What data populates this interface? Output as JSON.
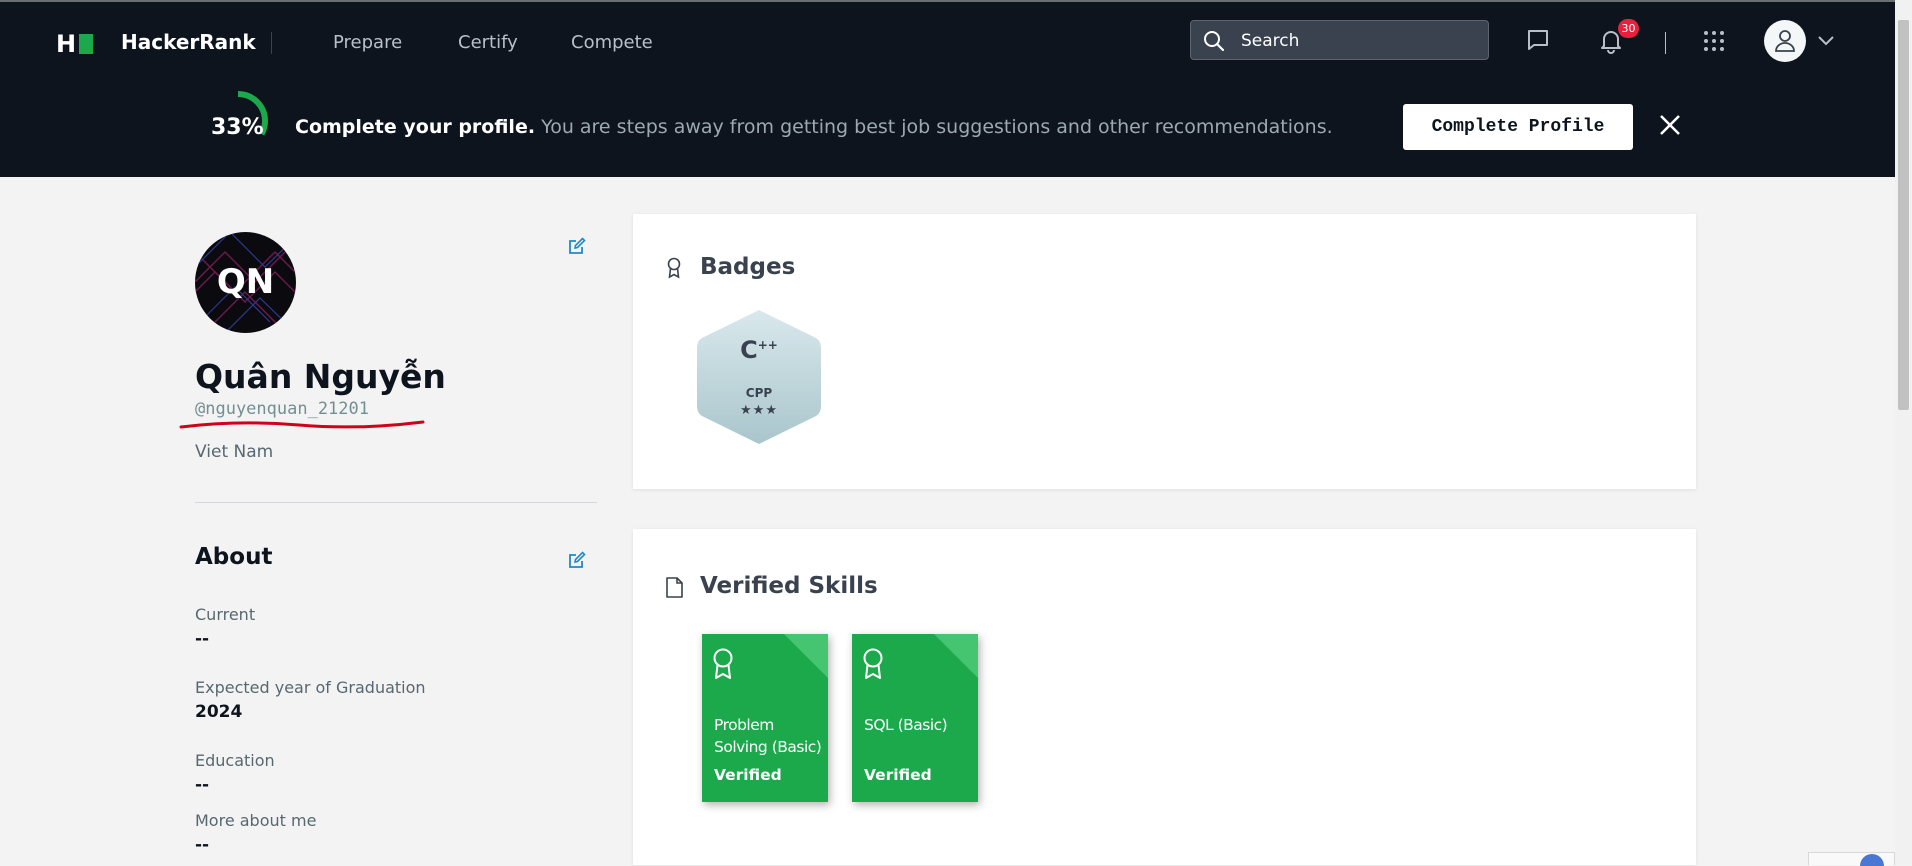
{
  "navbar": {
    "logo_letter": "H",
    "brand": "HackerRank",
    "links": [
      "Prepare",
      "Certify",
      "Compete"
    ],
    "search_placeholder": "Search",
    "notification_count": "30"
  },
  "banner": {
    "progress_percent": 33,
    "progress_text": "33%",
    "title": "Complete your profile.",
    "subtitle": "You are steps away from getting best job suggestions and other recommendations.",
    "button_label": "Complete Profile"
  },
  "profile": {
    "initials": "QN",
    "name": "Quân Nguyễn",
    "handle": "@nguyenquan_21201",
    "country": "Viet Nam"
  },
  "about": {
    "title": "About",
    "fields": [
      {
        "label": "Current",
        "value": "--"
      },
      {
        "label": "Expected year of Graduation",
        "value": "2024"
      },
      {
        "label": "Education",
        "value": "--"
      },
      {
        "label": "More about me",
        "value": "--"
      }
    ]
  },
  "badges": {
    "title": "Badges",
    "items": [
      {
        "symbol": "C",
        "symbol_suffix": "++",
        "label": "CPP",
        "stars": "★★★",
        "star_count": 3
      }
    ]
  },
  "verified_skills": {
    "title": "Verified Skills",
    "items": [
      {
        "name": "Problem Solving (Basic)",
        "status": "Verified"
      },
      {
        "name": "SQL (Basic)",
        "status": "Verified"
      }
    ]
  },
  "colors": {
    "nav_bg": "#0e141e",
    "brand_green": "#1ba94c",
    "notification_red": "#e8203d",
    "edit_blue": "#1f8acb",
    "annotation_red": "#d0021b"
  }
}
